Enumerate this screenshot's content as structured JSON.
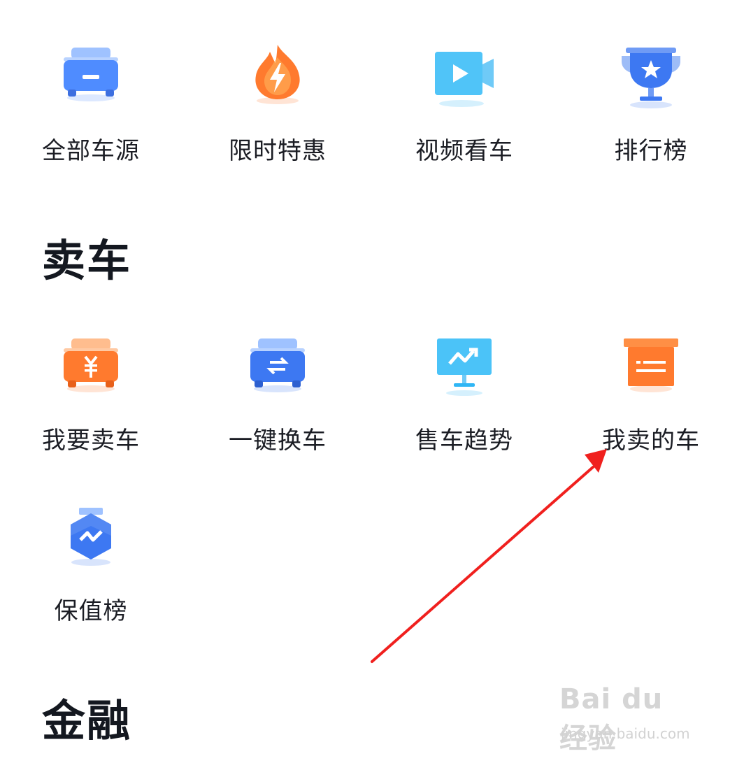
{
  "buy_grid": [
    {
      "label": "全部车源",
      "icon": "car-icon",
      "color": "#4f8cff"
    },
    {
      "label": "限时特惠",
      "icon": "flame-bolt-icon",
      "color": "#ff7a2e"
    },
    {
      "label": "视频看车",
      "icon": "video-camera-icon",
      "color": "#2fb6f5"
    },
    {
      "label": "排行榜",
      "icon": "trophy-icon",
      "color": "#3d78f2"
    }
  ],
  "sell_section": {
    "title": "卖车",
    "items": [
      {
        "label": "我要卖车",
        "icon": "car-yuan-icon",
        "color": "#ff7a2e"
      },
      {
        "label": "一键换车",
        "icon": "car-swap-icon",
        "color": "#3d78f2"
      },
      {
        "label": "售车趋势",
        "icon": "trend-monitor-icon",
        "color": "#2fb6f5"
      },
      {
        "label": "我卖的车",
        "icon": "box-list-icon",
        "color": "#ff7a2e"
      },
      {
        "label": "保值榜",
        "icon": "hexagon-medal-icon",
        "color": "#3d78f2"
      }
    ]
  },
  "finance_section": {
    "title": "金融"
  },
  "annotation": {
    "arrow_color": "#f0201e"
  },
  "watermark": {
    "logo": "Bai du 经验",
    "url": "jingyan.baidu.com"
  }
}
